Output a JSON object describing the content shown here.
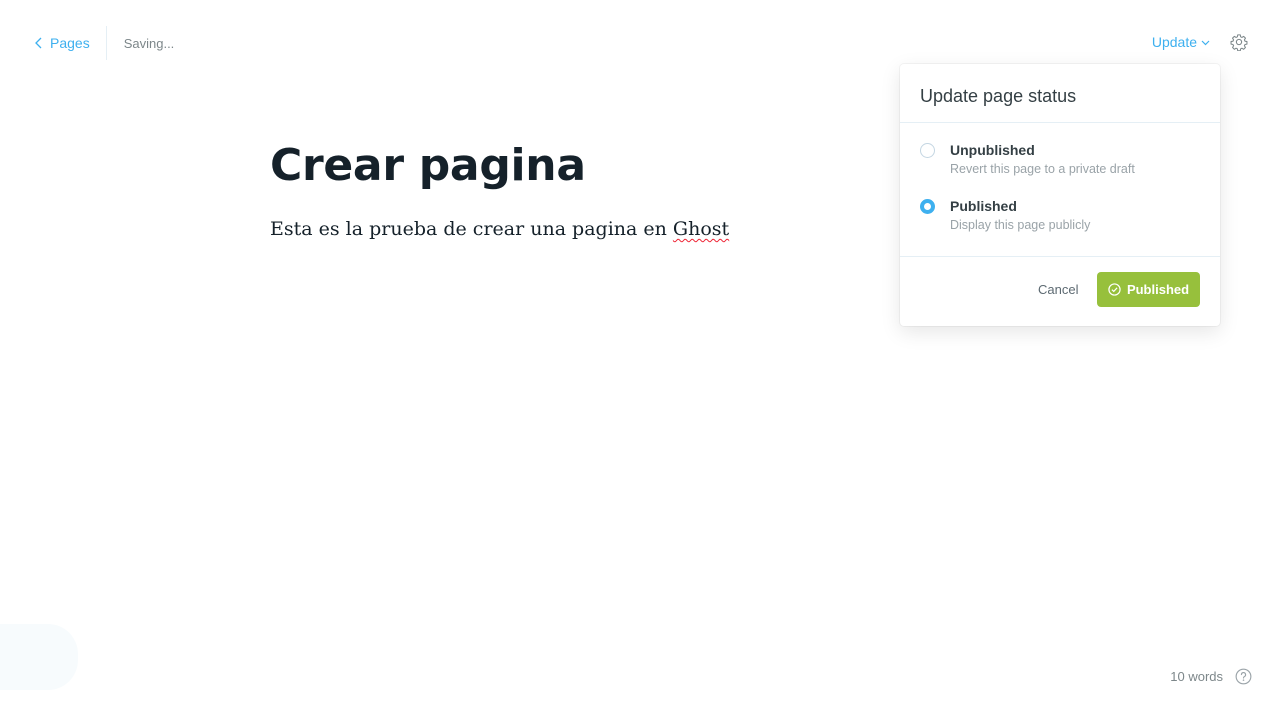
{
  "header": {
    "back_label": "Pages",
    "status_text": "Saving...",
    "update_label": "Update"
  },
  "editor": {
    "title": "Crear pagina",
    "body_prefix": "Esta es la prueba de crear una pagina en ",
    "body_flagged_word": "Ghost"
  },
  "popover": {
    "title": "Update page status",
    "options": [
      {
        "label": "Unpublished",
        "description": "Revert this page to a private draft",
        "selected": false
      },
      {
        "label": "Published",
        "description": "Display this page publicly",
        "selected": true
      }
    ],
    "cancel_label": "Cancel",
    "confirm_label": "Published"
  },
  "footer": {
    "word_count": "10 words"
  },
  "colors": {
    "accent": "#3eb0ef",
    "publish_green": "#97c03c",
    "text_dark": "#15212a"
  },
  "icons": [
    "chevron-left-icon",
    "chevron-down-icon",
    "gear-icon",
    "check-circle-icon",
    "help-icon"
  ]
}
